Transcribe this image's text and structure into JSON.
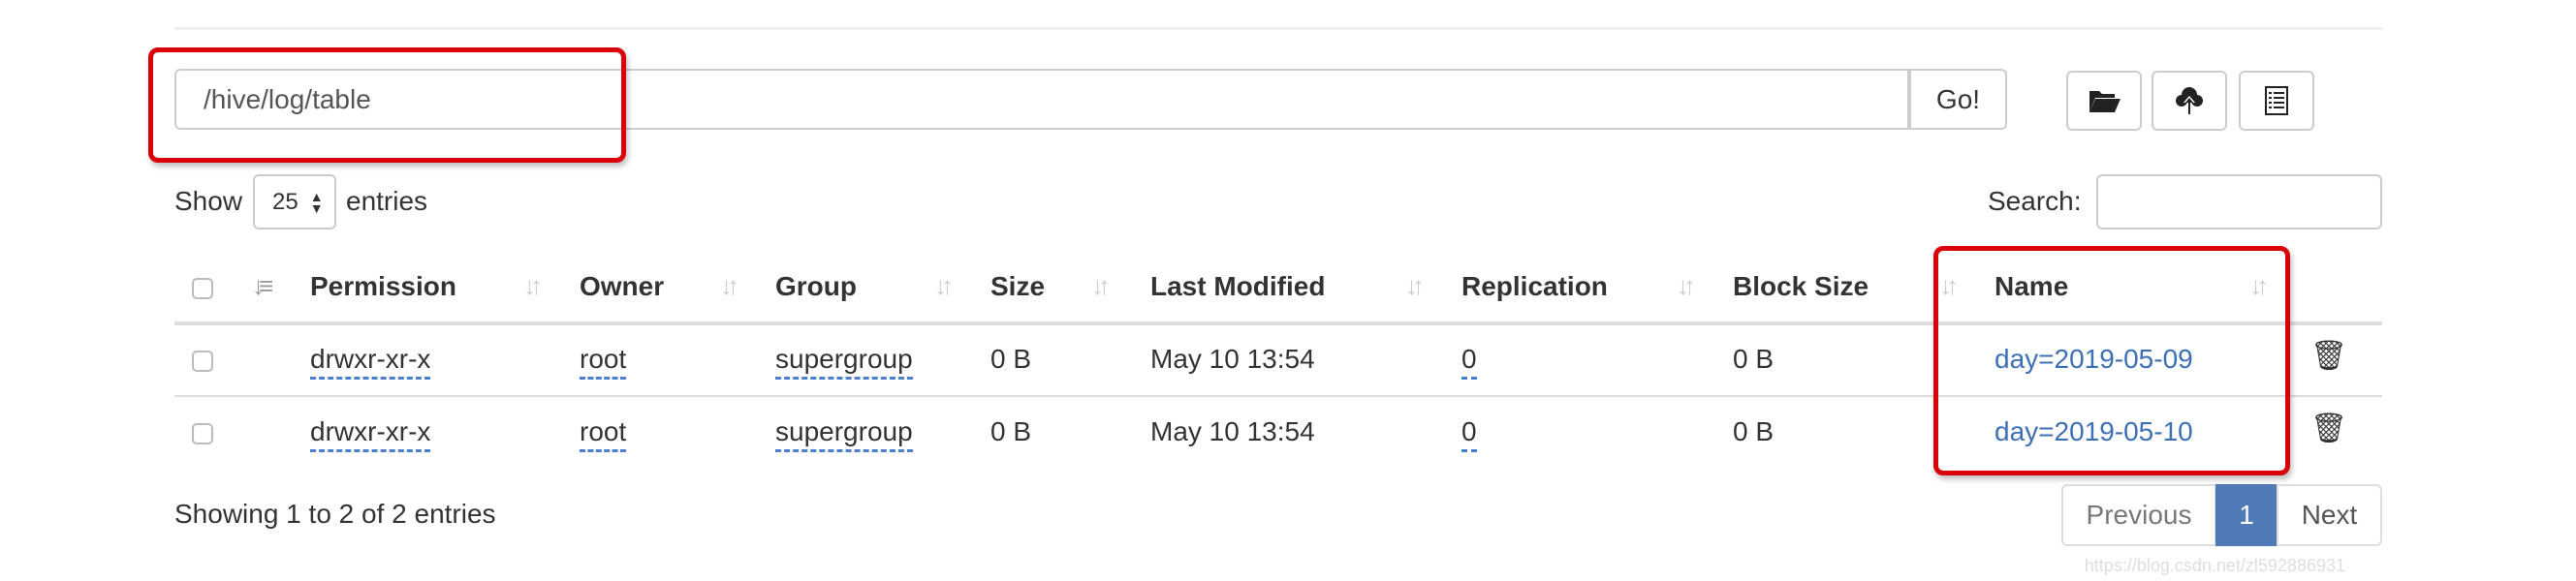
{
  "path_input": {
    "value": "/hive/log/table",
    "go_label": "Go!"
  },
  "toolbar": {
    "icons": [
      "folder-open-icon",
      "cloud-upload-icon",
      "list-icon"
    ]
  },
  "length": {
    "show": "Show",
    "value": "25",
    "entries": "entries"
  },
  "search": {
    "label": "Search:",
    "value": ""
  },
  "columns": [
    "Permission",
    "Owner",
    "Group",
    "Size",
    "Last Modified",
    "Replication",
    "Block Size",
    "Name"
  ],
  "rows": [
    {
      "permission": "drwxr-xr-x",
      "owner": "root",
      "group": "supergroup",
      "size": "0 B",
      "modified": "May 10 13:54",
      "replication": "0",
      "block_size": "0 B",
      "name": "day=2019-05-09"
    },
    {
      "permission": "drwxr-xr-x",
      "owner": "root",
      "group": "supergroup",
      "size": "0 B",
      "modified": "May 10 13:54",
      "replication": "0",
      "block_size": "0 B",
      "name": "day=2019-05-10"
    }
  ],
  "footer": {
    "info": "Showing 1 to 2 of 2 entries",
    "previous": "Previous",
    "page": "1",
    "next": "Next"
  },
  "watermark": "https://blog.csdn.net/zl592886931",
  "colors": {
    "highlight": "#d9000a",
    "link": "#3c6fb6",
    "active_page": "#4f7ab5"
  }
}
